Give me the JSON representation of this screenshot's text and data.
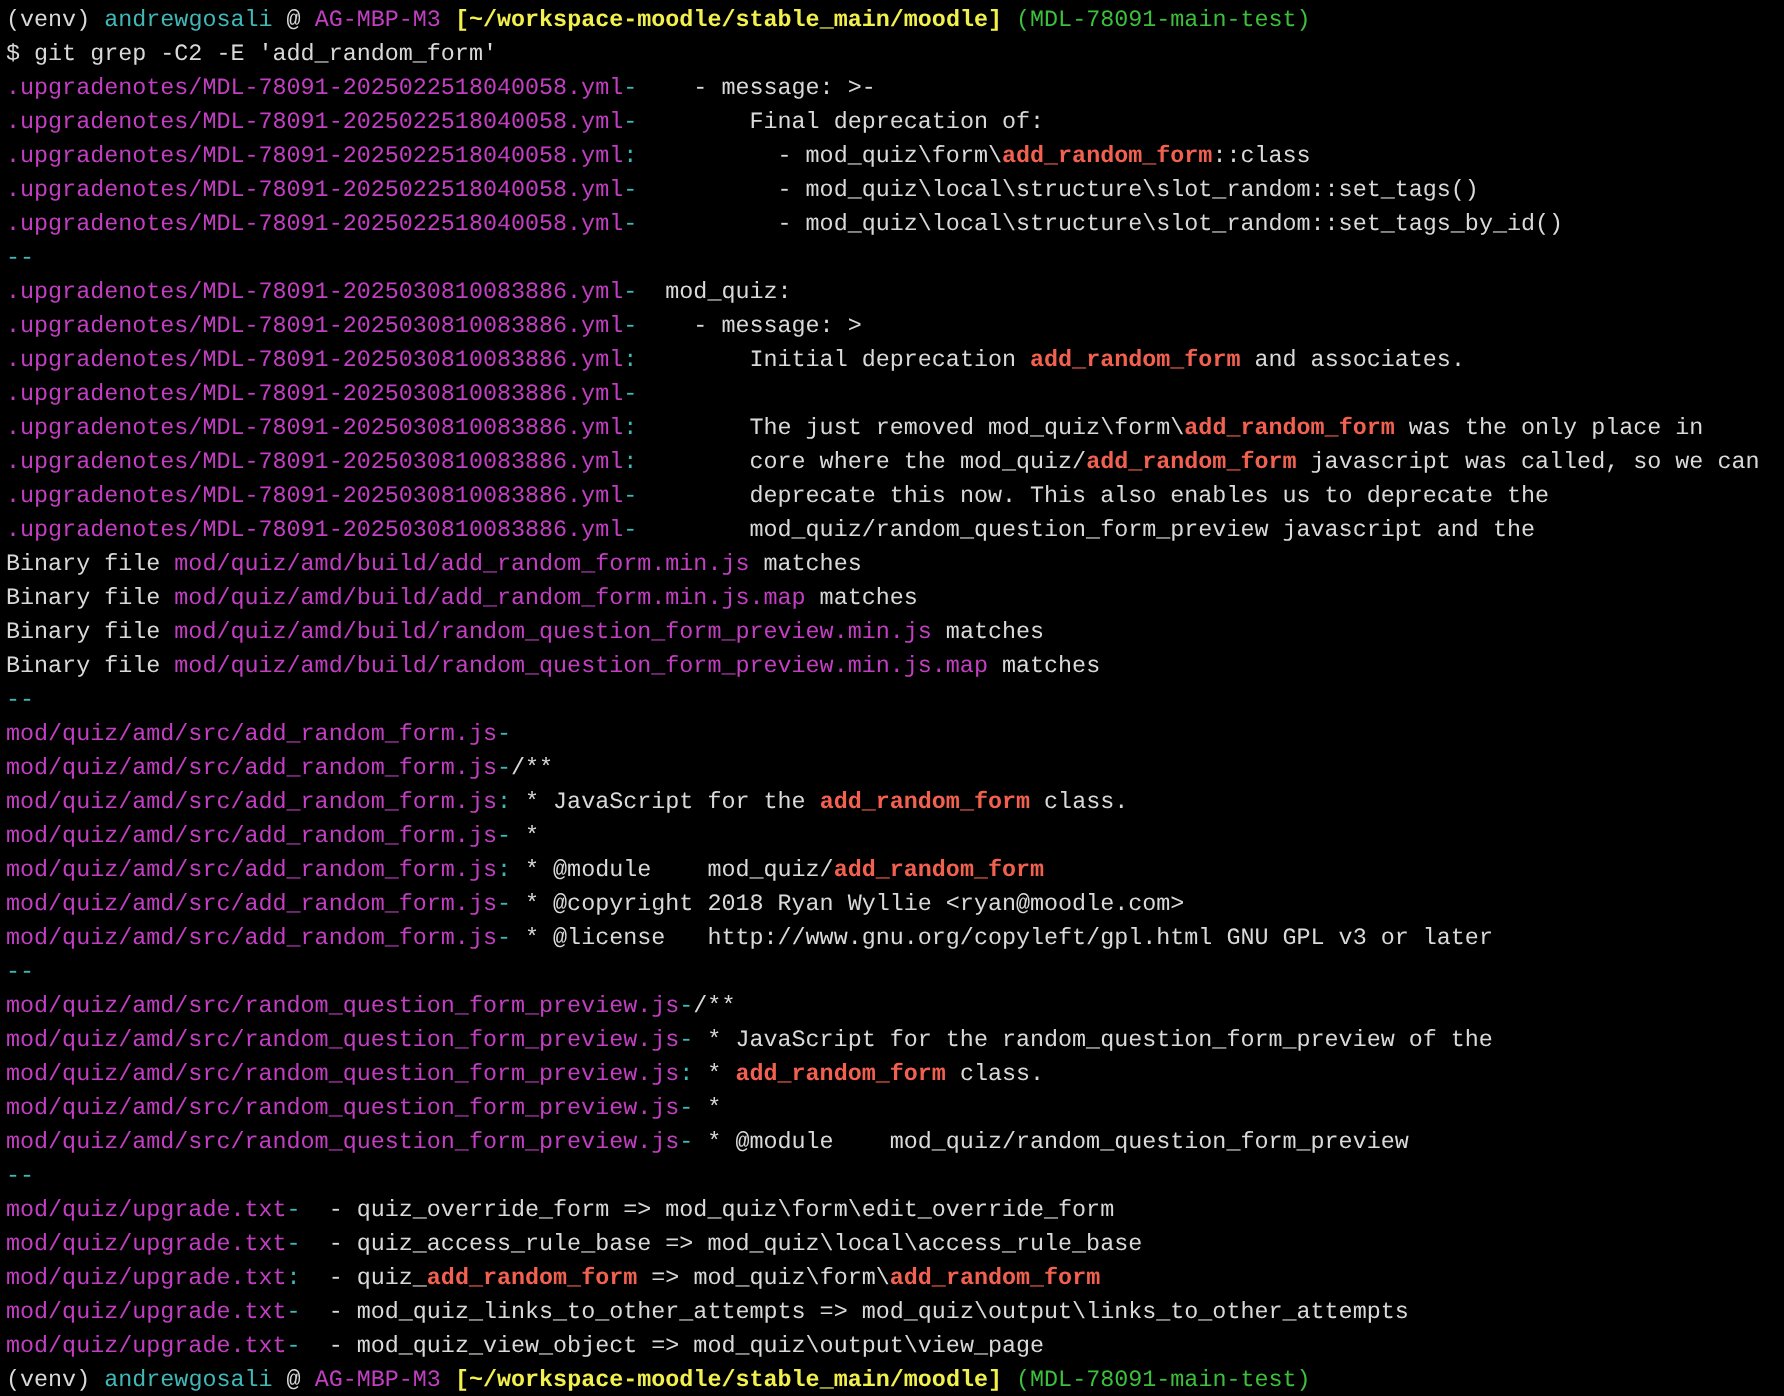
{
  "terminal": {
    "lines": [
      [
        {
          "kind": "plain",
          "text": "(venv) "
        },
        {
          "kind": "user",
          "text": "andrewgosali"
        },
        {
          "kind": "plain",
          "text": " @ "
        },
        {
          "kind": "host",
          "text": "AG-MBP-M3"
        },
        {
          "kind": "dir",
          "text": " [~/workspace-moodle/stable_main/moodle]"
        },
        {
          "kind": "branch",
          "text": " (MDL-78091-main-test)"
        }
      ],
      [
        {
          "kind": "plain",
          "text": "$ git grep -C2 -E 'add_random_form'"
        }
      ],
      [
        {
          "kind": "path",
          "text": ".upgradenotes/MDL-78091-2025022518040058.yml"
        },
        {
          "kind": "sep",
          "text": "-"
        },
        {
          "kind": "plain",
          "text": "    - message: >-"
        }
      ],
      [
        {
          "kind": "path",
          "text": ".upgradenotes/MDL-78091-2025022518040058.yml"
        },
        {
          "kind": "sep",
          "text": "-"
        },
        {
          "kind": "plain",
          "text": "        Final deprecation of:"
        }
      ],
      [
        {
          "kind": "path",
          "text": ".upgradenotes/MDL-78091-2025022518040058.yml"
        },
        {
          "kind": "sep",
          "text": ":"
        },
        {
          "kind": "plain",
          "text": "          - mod_quiz\\form\\"
        },
        {
          "kind": "match",
          "text": "add_random_form"
        },
        {
          "kind": "plain",
          "text": "::class"
        }
      ],
      [
        {
          "kind": "path",
          "text": ".upgradenotes/MDL-78091-2025022518040058.yml"
        },
        {
          "kind": "sep",
          "text": "-"
        },
        {
          "kind": "plain",
          "text": "          - mod_quiz\\local\\structure\\slot_random::set_tags()"
        }
      ],
      [
        {
          "kind": "path",
          "text": ".upgradenotes/MDL-78091-2025022518040058.yml"
        },
        {
          "kind": "sep",
          "text": "-"
        },
        {
          "kind": "plain",
          "text": "          - mod_quiz\\local\\structure\\slot_random::set_tags_by_id()"
        }
      ],
      [
        {
          "kind": "sep",
          "text": "--"
        }
      ],
      [
        {
          "kind": "path",
          "text": ".upgradenotes/MDL-78091-2025030810083886.yml"
        },
        {
          "kind": "sep",
          "text": "-"
        },
        {
          "kind": "plain",
          "text": "  mod_quiz:"
        }
      ],
      [
        {
          "kind": "path",
          "text": ".upgradenotes/MDL-78091-2025030810083886.yml"
        },
        {
          "kind": "sep",
          "text": "-"
        },
        {
          "kind": "plain",
          "text": "    - message: >"
        }
      ],
      [
        {
          "kind": "path",
          "text": ".upgradenotes/MDL-78091-2025030810083886.yml"
        },
        {
          "kind": "sep",
          "text": ":"
        },
        {
          "kind": "plain",
          "text": "        Initial deprecation "
        },
        {
          "kind": "match",
          "text": "add_random_form"
        },
        {
          "kind": "plain",
          "text": " and associates."
        }
      ],
      [
        {
          "kind": "path",
          "text": ".upgradenotes/MDL-78091-2025030810083886.yml"
        },
        {
          "kind": "sep",
          "text": "-"
        }
      ],
      [
        {
          "kind": "path",
          "text": ".upgradenotes/MDL-78091-2025030810083886.yml"
        },
        {
          "kind": "sep",
          "text": ":"
        },
        {
          "kind": "plain",
          "text": "        The just removed mod_quiz\\form\\"
        },
        {
          "kind": "match",
          "text": "add_random_form"
        },
        {
          "kind": "plain",
          "text": " was the only place in"
        }
      ],
      [
        {
          "kind": "path",
          "text": ".upgradenotes/MDL-78091-2025030810083886.yml"
        },
        {
          "kind": "sep",
          "text": ":"
        },
        {
          "kind": "plain",
          "text": "        core where the mod_quiz/"
        },
        {
          "kind": "match",
          "text": "add_random_form"
        },
        {
          "kind": "plain",
          "text": " javascript was called, so we can"
        }
      ],
      [
        {
          "kind": "path",
          "text": ".upgradenotes/MDL-78091-2025030810083886.yml"
        },
        {
          "kind": "sep",
          "text": "-"
        },
        {
          "kind": "plain",
          "text": "        deprecate this now. This also enables us to deprecate the"
        }
      ],
      [
        {
          "kind": "path",
          "text": ".upgradenotes/MDL-78091-2025030810083886.yml"
        },
        {
          "kind": "sep",
          "text": "-"
        },
        {
          "kind": "plain",
          "text": "        mod_quiz/random_question_form_preview javascript and the"
        }
      ],
      [
        {
          "kind": "plain",
          "text": "Binary file "
        },
        {
          "kind": "path",
          "text": "mod/quiz/amd/build/add_random_form.min.js"
        },
        {
          "kind": "plain",
          "text": " matches"
        }
      ],
      [
        {
          "kind": "plain",
          "text": "Binary file "
        },
        {
          "kind": "path",
          "text": "mod/quiz/amd/build/add_random_form.min.js.map"
        },
        {
          "kind": "plain",
          "text": " matches"
        }
      ],
      [
        {
          "kind": "plain",
          "text": "Binary file "
        },
        {
          "kind": "path",
          "text": "mod/quiz/amd/build/random_question_form_preview.min.js"
        },
        {
          "kind": "plain",
          "text": " matches"
        }
      ],
      [
        {
          "kind": "plain",
          "text": "Binary file "
        },
        {
          "kind": "path",
          "text": "mod/quiz/amd/build/random_question_form_preview.min.js.map"
        },
        {
          "kind": "plain",
          "text": " matches"
        }
      ],
      [
        {
          "kind": "sep",
          "text": "--"
        }
      ],
      [
        {
          "kind": "path",
          "text": "mod/quiz/amd/src/add_random_form.js"
        },
        {
          "kind": "sep",
          "text": "-"
        }
      ],
      [
        {
          "kind": "path",
          "text": "mod/quiz/amd/src/add_random_form.js"
        },
        {
          "kind": "sep",
          "text": "-"
        },
        {
          "kind": "plain",
          "text": "/**"
        }
      ],
      [
        {
          "kind": "path",
          "text": "mod/quiz/amd/src/add_random_form.js"
        },
        {
          "kind": "sep",
          "text": ":"
        },
        {
          "kind": "plain",
          "text": " * JavaScript for the "
        },
        {
          "kind": "match",
          "text": "add_random_form"
        },
        {
          "kind": "plain",
          "text": " class."
        }
      ],
      [
        {
          "kind": "path",
          "text": "mod/quiz/amd/src/add_random_form.js"
        },
        {
          "kind": "sep",
          "text": "-"
        },
        {
          "kind": "plain",
          "text": " *"
        }
      ],
      [
        {
          "kind": "path",
          "text": "mod/quiz/amd/src/add_random_form.js"
        },
        {
          "kind": "sep",
          "text": ":"
        },
        {
          "kind": "plain",
          "text": " * @module    mod_quiz/"
        },
        {
          "kind": "match",
          "text": "add_random_form"
        }
      ],
      [
        {
          "kind": "path",
          "text": "mod/quiz/amd/src/add_random_form.js"
        },
        {
          "kind": "sep",
          "text": "-"
        },
        {
          "kind": "plain",
          "text": " * @copyright 2018 Ryan Wyllie <ryan@moodle.com>"
        }
      ],
      [
        {
          "kind": "path",
          "text": "mod/quiz/amd/src/add_random_form.js"
        },
        {
          "kind": "sep",
          "text": "-"
        },
        {
          "kind": "plain",
          "text": " * @license   http://www.gnu.org/copyleft/gpl.html GNU GPL v3 or later"
        }
      ],
      [
        {
          "kind": "sep",
          "text": "--"
        }
      ],
      [
        {
          "kind": "path",
          "text": "mod/quiz/amd/src/random_question_form_preview.js"
        },
        {
          "kind": "sep",
          "text": "-"
        },
        {
          "kind": "plain",
          "text": "/**"
        }
      ],
      [
        {
          "kind": "path",
          "text": "mod/quiz/amd/src/random_question_form_preview.js"
        },
        {
          "kind": "sep",
          "text": "-"
        },
        {
          "kind": "plain",
          "text": " * JavaScript for the random_question_form_preview of the"
        }
      ],
      [
        {
          "kind": "path",
          "text": "mod/quiz/amd/src/random_question_form_preview.js"
        },
        {
          "kind": "sep",
          "text": ":"
        },
        {
          "kind": "plain",
          "text": " * "
        },
        {
          "kind": "match",
          "text": "add_random_form"
        },
        {
          "kind": "plain",
          "text": " class."
        }
      ],
      [
        {
          "kind": "path",
          "text": "mod/quiz/amd/src/random_question_form_preview.js"
        },
        {
          "kind": "sep",
          "text": "-"
        },
        {
          "kind": "plain",
          "text": " *"
        }
      ],
      [
        {
          "kind": "path",
          "text": "mod/quiz/amd/src/random_question_form_preview.js"
        },
        {
          "kind": "sep",
          "text": "-"
        },
        {
          "kind": "plain",
          "text": " * @module    mod_quiz/random_question_form_preview"
        }
      ],
      [
        {
          "kind": "sep",
          "text": "--"
        }
      ],
      [
        {
          "kind": "path",
          "text": "mod/quiz/upgrade.txt"
        },
        {
          "kind": "sep",
          "text": "-"
        },
        {
          "kind": "plain",
          "text": "  - quiz_override_form => mod_quiz\\form\\edit_override_form"
        }
      ],
      [
        {
          "kind": "path",
          "text": "mod/quiz/upgrade.txt"
        },
        {
          "kind": "sep",
          "text": "-"
        },
        {
          "kind": "plain",
          "text": "  - quiz_access_rule_base => mod_quiz\\local\\access_rule_base"
        }
      ],
      [
        {
          "kind": "path",
          "text": "mod/quiz/upgrade.txt"
        },
        {
          "kind": "sep",
          "text": ":"
        },
        {
          "kind": "plain",
          "text": "  - quiz_"
        },
        {
          "kind": "match",
          "text": "add_random_form"
        },
        {
          "kind": "plain",
          "text": " => mod_quiz\\form\\"
        },
        {
          "kind": "match",
          "text": "add_random_form"
        }
      ],
      [
        {
          "kind": "path",
          "text": "mod/quiz/upgrade.txt"
        },
        {
          "kind": "sep",
          "text": "-"
        },
        {
          "kind": "plain",
          "text": "  - mod_quiz_links_to_other_attempts => mod_quiz\\output\\links_to_other_attempts"
        }
      ],
      [
        {
          "kind": "path",
          "text": "mod/quiz/upgrade.txt"
        },
        {
          "kind": "sep",
          "text": "-"
        },
        {
          "kind": "plain",
          "text": "  - mod_quiz_view_object => mod_quiz\\output\\view_page"
        }
      ],
      [
        {
          "kind": "plain",
          "text": "(venv) "
        },
        {
          "kind": "user",
          "text": "andrewgosali"
        },
        {
          "kind": "plain",
          "text": " @ "
        },
        {
          "kind": "host",
          "text": "AG-MBP-M3"
        },
        {
          "kind": "dir",
          "text": " [~/workspace-moodle/stable_main/moodle]"
        },
        {
          "kind": "branch",
          "text": " (MDL-78091-main-test)"
        }
      ]
    ]
  }
}
